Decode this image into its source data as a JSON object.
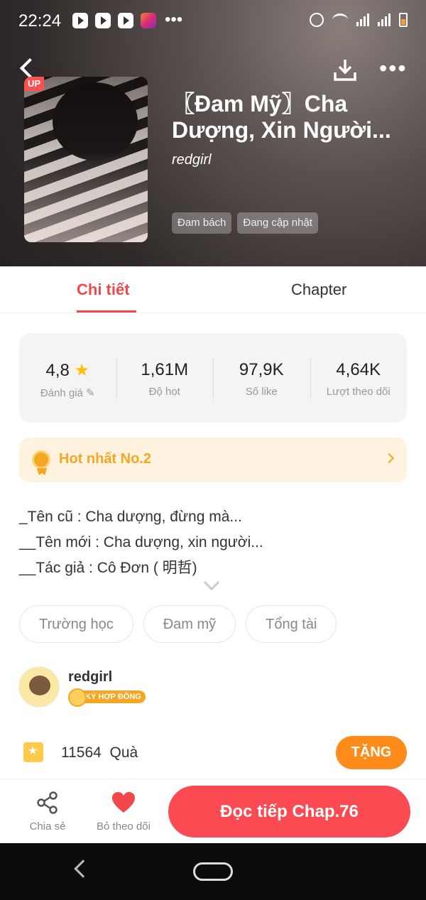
{
  "status_bar": {
    "time": "22:24"
  },
  "book": {
    "badge": "UP",
    "title": "〖Đam Mỹ〗Cha Dượng, Xin Người...",
    "author": "redgirl",
    "tags": [
      "Đam bách",
      "Đang cập nhật"
    ]
  },
  "tabs": {
    "details": "Chi tiết",
    "chapter": "Chapter"
  },
  "stats": [
    {
      "value": "4,8",
      "label": "Đánh giá"
    },
    {
      "value": "1,61M",
      "label": "Độ hot"
    },
    {
      "value": "97,9K",
      "label": "Số like"
    },
    {
      "value": "4,64K",
      "label": "Lượt theo dõi"
    }
  ],
  "hot_rank": "Hot nhất No.2",
  "description": [
    "_Tên cũ : Cha dượng, đừng mà...",
    "__Tên mới : Cha dượng, xin người...",
    "__Tác giả : Cô Đơn ( 明哲)"
  ],
  "genres": [
    "Trường học",
    "Đam mỹ",
    "Tổng tài"
  ],
  "uploader": {
    "name": "redgirl",
    "badge": "KÝ HỢP ĐỒNG"
  },
  "gifts": {
    "count": "11564",
    "label": "Quà",
    "button": "TẶNG"
  },
  "bottom": {
    "share": "Chia sẻ",
    "unfollow": "Bỏ theo dõi",
    "read": "Đọc tiếp Chap.76"
  },
  "colors": {
    "accent": "#f04848",
    "gold": "#f5a623",
    "orange": "#ff8c1a",
    "read_button": "#fc4a52"
  }
}
